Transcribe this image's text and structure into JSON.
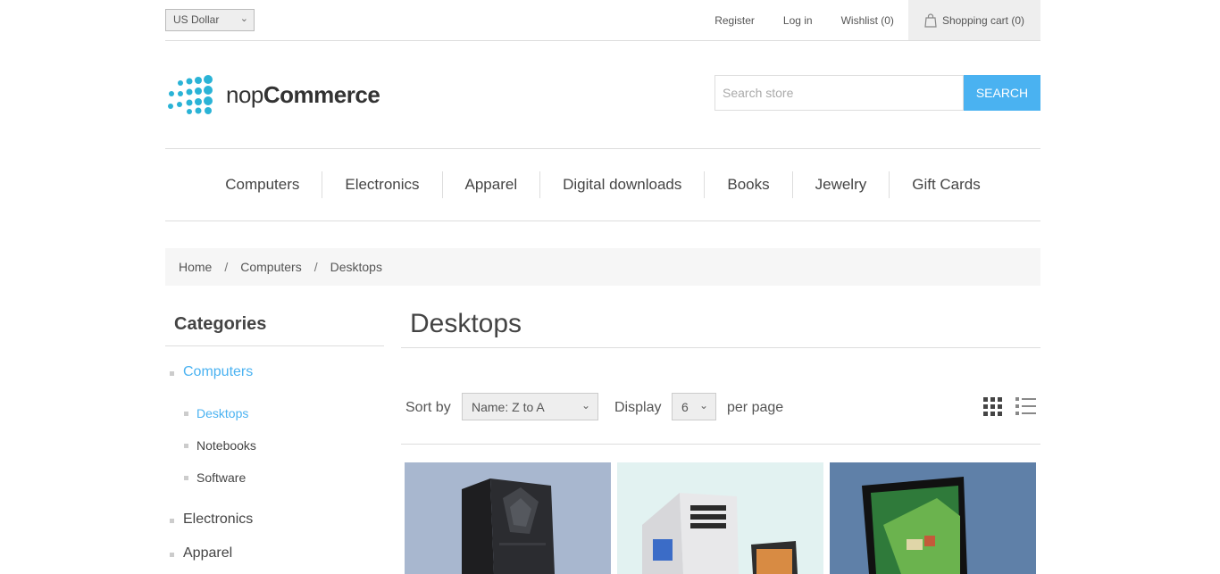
{
  "topbar": {
    "currency": "US Dollar",
    "links": [
      "Register",
      "Log in",
      "Wishlist (0)"
    ],
    "cart": "Shopping cart (0)"
  },
  "logo": {
    "prefix": "nop",
    "suffix": "Commerce"
  },
  "search": {
    "placeholder": "Search store",
    "button": "SEARCH"
  },
  "nav": [
    "Computers",
    "Electronics",
    "Apparel",
    "Digital downloads",
    "Books",
    "Jewelry",
    "Gift Cards"
  ],
  "breadcrumb": {
    "home": "Home",
    "sep": "/",
    "level1": "Computers",
    "current": "Desktops"
  },
  "sidebar": {
    "title": "Categories",
    "computers": "Computers",
    "sub": [
      "Desktops",
      "Notebooks",
      "Software"
    ],
    "electronics": "Electronics",
    "apparel": "Apparel"
  },
  "main": {
    "title": "Desktops",
    "sort_label": "Sort by",
    "sort_value": "Name: Z to A",
    "display_label": "Display",
    "display_value": "6",
    "per_page": "per page"
  },
  "colors": {
    "accent": "#4ab2f1"
  }
}
